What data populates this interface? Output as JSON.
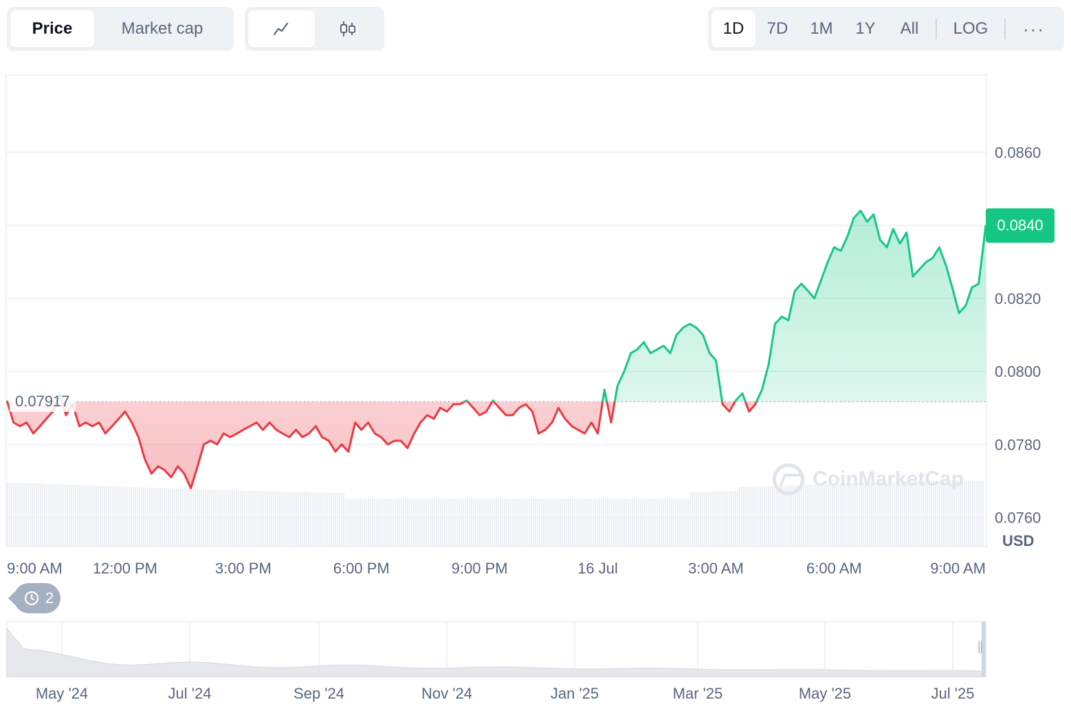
{
  "tabs": [
    {
      "label": "Price",
      "active": true
    },
    {
      "label": "Market cap",
      "active": false
    }
  ],
  "chart_type_buttons": [
    {
      "icon": "line-chart-icon",
      "active": true
    },
    {
      "icon": "candlestick-chart-icon",
      "active": false
    }
  ],
  "ranges": [
    {
      "label": "1D",
      "active": true
    },
    {
      "label": "7D",
      "active": false
    },
    {
      "label": "1M",
      "active": false
    },
    {
      "label": "1Y",
      "active": false
    },
    {
      "label": "All",
      "active": false
    }
  ],
  "log_label": "LOG",
  "more_label": "···",
  "history_badge": {
    "icon": "history-icon",
    "count": "2"
  },
  "watermark": "CoinMarketCap",
  "colors": {
    "up": "#16c784",
    "down": "#ea3943",
    "grid": "#eff2f5",
    "axis_text": "#58667e",
    "navigator": "#e6e8ec"
  },
  "chart_data": {
    "type": "line",
    "currency": "USD",
    "open_price": 0.07917,
    "open_price_label": "0.07917",
    "current_price": 0.084,
    "current_price_label": "0.0840",
    "ylim": [
      0.0752,
      0.0881
    ],
    "y_ticks": [
      "0.0760",
      "0.0780",
      "0.0800",
      "0.0820",
      "0.0840",
      "0.0860"
    ],
    "y_tick_values": [
      0.076,
      0.078,
      0.08,
      0.082,
      0.084,
      0.086
    ],
    "x_ticks": [
      "9:00 AM",
      "12:00 PM",
      "3:00 PM",
      "6:00 PM",
      "9:00 PM",
      "16 Jul",
      "3:00 AM",
      "6:00 AM",
      "9:00 AM"
    ],
    "x_tick_hours": [
      0,
      3,
      6,
      9,
      12,
      15,
      18,
      21,
      24
    ],
    "x_hours_span": 24.85,
    "series": [
      {
        "values": [
          [
            0.0,
            0.0792
          ],
          [
            0.17,
            0.0786
          ],
          [
            0.33,
            0.0785
          ],
          [
            0.5,
            0.0786
          ],
          [
            0.67,
            0.0783
          ],
          [
            0.84,
            0.0785
          ],
          [
            1.0,
            0.0787
          ],
          [
            1.17,
            0.0789
          ],
          [
            1.34,
            0.0794
          ],
          [
            1.5,
            0.0788
          ],
          [
            1.67,
            0.0791
          ],
          [
            1.84,
            0.0785
          ],
          [
            2.0,
            0.0786
          ],
          [
            2.17,
            0.0785
          ],
          [
            2.34,
            0.0786
          ],
          [
            2.5,
            0.0783
          ],
          [
            2.67,
            0.0785
          ],
          [
            2.84,
            0.0787
          ],
          [
            3.0,
            0.0789
          ],
          [
            3.17,
            0.0786
          ],
          [
            3.34,
            0.0782
          ],
          [
            3.5,
            0.0776
          ],
          [
            3.67,
            0.0772
          ],
          [
            3.84,
            0.0774
          ],
          [
            4.0,
            0.0773
          ],
          [
            4.17,
            0.0771
          ],
          [
            4.34,
            0.0774
          ],
          [
            4.5,
            0.0772
          ],
          [
            4.67,
            0.0768
          ],
          [
            4.84,
            0.0774
          ],
          [
            5.0,
            0.078
          ],
          [
            5.17,
            0.0781
          ],
          [
            5.34,
            0.078
          ],
          [
            5.5,
            0.0783
          ],
          [
            5.67,
            0.0782
          ],
          [
            5.84,
            0.0783
          ],
          [
            6.0,
            0.0784
          ],
          [
            6.17,
            0.0785
          ],
          [
            6.34,
            0.0786
          ],
          [
            6.5,
            0.0784
          ],
          [
            6.67,
            0.0786
          ],
          [
            6.84,
            0.0784
          ],
          [
            7.0,
            0.0783
          ],
          [
            7.17,
            0.0782
          ],
          [
            7.34,
            0.0784
          ],
          [
            7.5,
            0.0782
          ],
          [
            7.67,
            0.0783
          ],
          [
            7.84,
            0.0785
          ],
          [
            8.0,
            0.0782
          ],
          [
            8.17,
            0.0781
          ],
          [
            8.34,
            0.0778
          ],
          [
            8.5,
            0.078
          ],
          [
            8.67,
            0.0778
          ],
          [
            8.84,
            0.0786
          ],
          [
            9.0,
            0.0784
          ],
          [
            9.17,
            0.0786
          ],
          [
            9.34,
            0.0783
          ],
          [
            9.5,
            0.0782
          ],
          [
            9.67,
            0.078
          ],
          [
            9.84,
            0.0781
          ],
          [
            10.0,
            0.0781
          ],
          [
            10.17,
            0.0779
          ],
          [
            10.34,
            0.0783
          ],
          [
            10.5,
            0.0786
          ],
          [
            10.67,
            0.0788
          ],
          [
            10.84,
            0.0787
          ],
          [
            11.0,
            0.079
          ],
          [
            11.17,
            0.0789
          ],
          [
            11.34,
            0.0791
          ],
          [
            11.5,
            0.0791
          ],
          [
            11.67,
            0.0792
          ],
          [
            11.84,
            0.079
          ],
          [
            12.0,
            0.0788
          ],
          [
            12.17,
            0.0789
          ],
          [
            12.34,
            0.0792
          ],
          [
            12.5,
            0.079
          ],
          [
            12.67,
            0.0788
          ],
          [
            12.84,
            0.0788
          ],
          [
            13.0,
            0.079
          ],
          [
            13.17,
            0.0791
          ],
          [
            13.34,
            0.0789
          ],
          [
            13.5,
            0.0783
          ],
          [
            13.67,
            0.0784
          ],
          [
            13.84,
            0.0786
          ],
          [
            14.0,
            0.079
          ],
          [
            14.17,
            0.0787
          ],
          [
            14.34,
            0.0785
          ],
          [
            14.5,
            0.0784
          ],
          [
            14.67,
            0.0783
          ],
          [
            14.84,
            0.0786
          ],
          [
            15.0,
            0.0783
          ],
          [
            15.17,
            0.0795
          ],
          [
            15.34,
            0.0786
          ],
          [
            15.5,
            0.0796
          ],
          [
            15.67,
            0.08
          ],
          [
            15.84,
            0.0805
          ],
          [
            16.0,
            0.0806
          ],
          [
            16.17,
            0.0808
          ],
          [
            16.34,
            0.0805
          ],
          [
            16.5,
            0.0806
          ],
          [
            16.67,
            0.0807
          ],
          [
            16.84,
            0.0805
          ],
          [
            17.0,
            0.081
          ],
          [
            17.17,
            0.0812
          ],
          [
            17.34,
            0.0813
          ],
          [
            17.5,
            0.0812
          ],
          [
            17.67,
            0.081
          ],
          [
            17.84,
            0.0805
          ],
          [
            18.0,
            0.0803
          ],
          [
            18.17,
            0.0791
          ],
          [
            18.34,
            0.0789
          ],
          [
            18.5,
            0.0792
          ],
          [
            18.67,
            0.0794
          ],
          [
            18.84,
            0.0789
          ],
          [
            19.0,
            0.0791
          ],
          [
            19.17,
            0.0795
          ],
          [
            19.34,
            0.0802
          ],
          [
            19.5,
            0.0813
          ],
          [
            19.67,
            0.0815
          ],
          [
            19.84,
            0.0814
          ],
          [
            20.0,
            0.0822
          ],
          [
            20.17,
            0.0824
          ],
          [
            20.34,
            0.0822
          ],
          [
            20.5,
            0.082
          ],
          [
            20.67,
            0.0825
          ],
          [
            20.84,
            0.083
          ],
          [
            21.0,
            0.0834
          ],
          [
            21.17,
            0.0833
          ],
          [
            21.34,
            0.0837
          ],
          [
            21.5,
            0.0842
          ],
          [
            21.67,
            0.0844
          ],
          [
            21.84,
            0.0841
          ],
          [
            22.0,
            0.0843
          ],
          [
            22.17,
            0.0836
          ],
          [
            22.34,
            0.0834
          ],
          [
            22.5,
            0.0839
          ],
          [
            22.67,
            0.0835
          ],
          [
            22.84,
            0.0838
          ],
          [
            23.0,
            0.0826
          ],
          [
            23.17,
            0.0828
          ],
          [
            23.34,
            0.083
          ],
          [
            23.5,
            0.0831
          ],
          [
            23.67,
            0.0834
          ],
          [
            23.84,
            0.0829
          ],
          [
            24.0,
            0.0823
          ],
          [
            24.17,
            0.0816
          ],
          [
            24.34,
            0.0818
          ],
          [
            24.5,
            0.0823
          ],
          [
            24.67,
            0.0824
          ],
          [
            24.85,
            0.084
          ]
        ]
      }
    ]
  }
}
